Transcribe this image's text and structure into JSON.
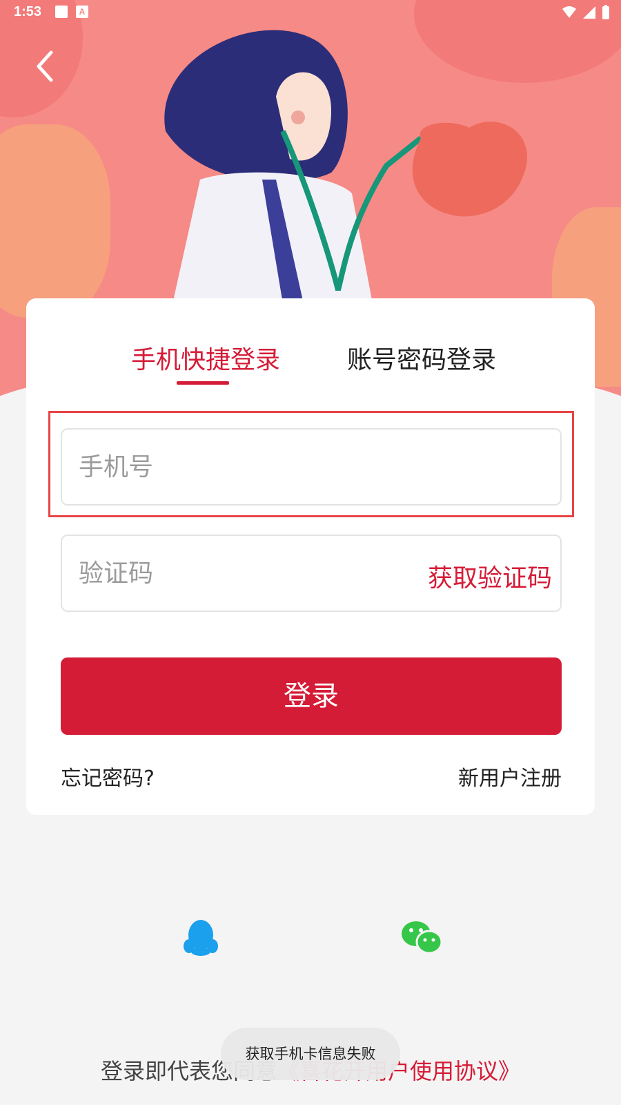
{
  "status_bar": {
    "time": "1:53"
  },
  "tabs": {
    "active": "手机快捷登录",
    "inactive": "账号密码登录"
  },
  "form": {
    "phone_placeholder": "手机号",
    "code_placeholder": "验证码",
    "get_code_label": "获取验证码",
    "login_label": "登录",
    "forgot_label": "忘记密码?",
    "register_label": "新用户注册"
  },
  "agreement": {
    "prefix": "登录即代表您同意",
    "link": "《喜花开用户使用协议》"
  },
  "toast": "获取手机卡信息失败",
  "colors": {
    "accent": "#d51c37",
    "hero_bg": "#f68a86",
    "page_bg": "#f4f4f4"
  },
  "icons": {
    "back": "chevron-left-icon",
    "qq": "qq-icon",
    "wechat": "wechat-icon"
  }
}
